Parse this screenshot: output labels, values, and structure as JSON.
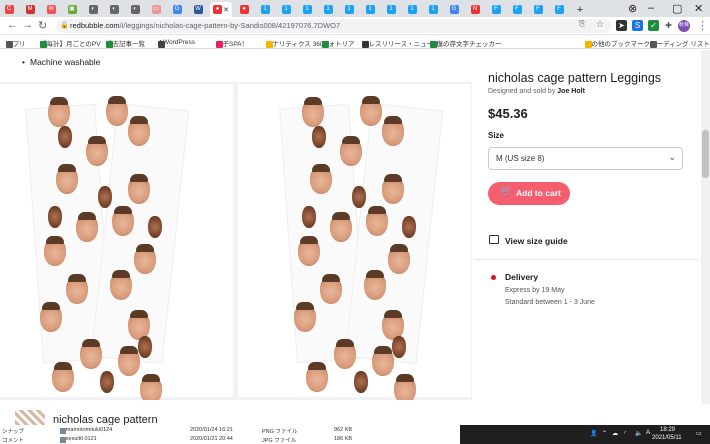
{
  "browser": {
    "url_host": "redbubble.com",
    "url_path": "/i/leggings/nicholas-cage-pattern-by-Sandis008/42197076.7DWO7",
    "tabs": [
      {
        "letter": "C",
        "color": "#e44"
      },
      {
        "letter": "M",
        "color": "#c33"
      },
      {
        "letter": "✉",
        "color": "#e55"
      },
      {
        "letter": "▣",
        "color": "#6a3"
      },
      {
        "letter": "◐",
        "color": "#666"
      },
      {
        "letter": "◐",
        "color": "#666"
      },
      {
        "letter": "◐",
        "color": "#666"
      },
      {
        "letter": "▭",
        "color": "#e99"
      },
      {
        "letter": "G",
        "color": "#4285f4"
      },
      {
        "letter": "W",
        "color": "#2b579a"
      },
      {
        "letter": "●",
        "color": "#e33"
      },
      {
        "letter": "●",
        "color": "#e33"
      },
      {
        "letter": "1",
        "color": "#1da1f2"
      },
      {
        "letter": "1",
        "color": "#1da1f2"
      },
      {
        "letter": "1",
        "color": "#1da1f2"
      },
      {
        "letter": "1",
        "color": "#1da1f2"
      },
      {
        "letter": "1",
        "color": "#1da1f2"
      },
      {
        "letter": "1",
        "color": "#1da1f2"
      },
      {
        "letter": "1",
        "color": "#1da1f2"
      },
      {
        "letter": "1",
        "color": "#1da1f2"
      },
      {
        "letter": "1",
        "color": "#1da1f2"
      },
      {
        "letter": "G",
        "color": "#4285f4"
      },
      {
        "letter": "N",
        "color": "#e33"
      },
      {
        "letter": "F",
        "color": "#1da1f2"
      },
      {
        "letter": "F",
        "color": "#1da1f2"
      },
      {
        "letter": "F",
        "color": "#1da1f2"
      },
      {
        "letter": "F",
        "color": "#1da1f2"
      }
    ],
    "new_tab": "+",
    "avatar": "秋良"
  },
  "bookmarks": [
    {
      "label": "アプリ",
      "color": "#555"
    },
    {
      "label": "【毎計】月ごとのPV",
      "color": "#1e8e3e"
    },
    {
      "label": "過去記事一覧",
      "color": "#1e8e3e"
    },
    {
      "label": "◆WordPress",
      "color": "#444"
    },
    {
      "label": "女子SPA！",
      "color": "#e91e63"
    },
    {
      "label": "アナリティクス 360",
      "color": "#f4b400"
    },
    {
      "label": "フォトリア",
      "color": "#1e8e3e"
    },
    {
      "label": "プレスリリース・ニュース...",
      "color": "#333"
    },
    {
      "label": "報復の存文字チェッカー",
      "color": "#1e8e3e"
    },
    {
      "label": "その他のブックマーク",
      "color": "#f4b400"
    },
    {
      "label": "リーディング リスト",
      "color": "#555"
    }
  ],
  "product": {
    "bullet": "Machine washable",
    "title": "nicholas cage pattern Leggings",
    "designed_prefix": "Designed and sold by",
    "designer": "Joe Holt",
    "price": "$45.36",
    "size_label": "Size",
    "size_value": "M (US size 8)",
    "cart_label": "Add to cart",
    "size_guide": "View size guide",
    "delivery_title": "Delivery",
    "express": "Express by 19 May",
    "standard": "Standard between 1 - 3 June",
    "bottom_title": "nicholas cage pattern"
  },
  "explorer": {
    "rows": [
      {
        "left": "シナップ",
        "name": "yamamotomituki0124",
        "date": "2020/01/24 16:21",
        "type": "PNG ファイル",
        "size": "962 KB"
      },
      {
        "left": "コメント",
        "name": "yasesuitti 0121",
        "date": "2020/01/21 20:44",
        "type": "JPG ファイル",
        "size": "186 KB"
      }
    ]
  },
  "taskbar": {
    "time": "18:29",
    "date": "2021/05/11",
    "ime": "A"
  }
}
